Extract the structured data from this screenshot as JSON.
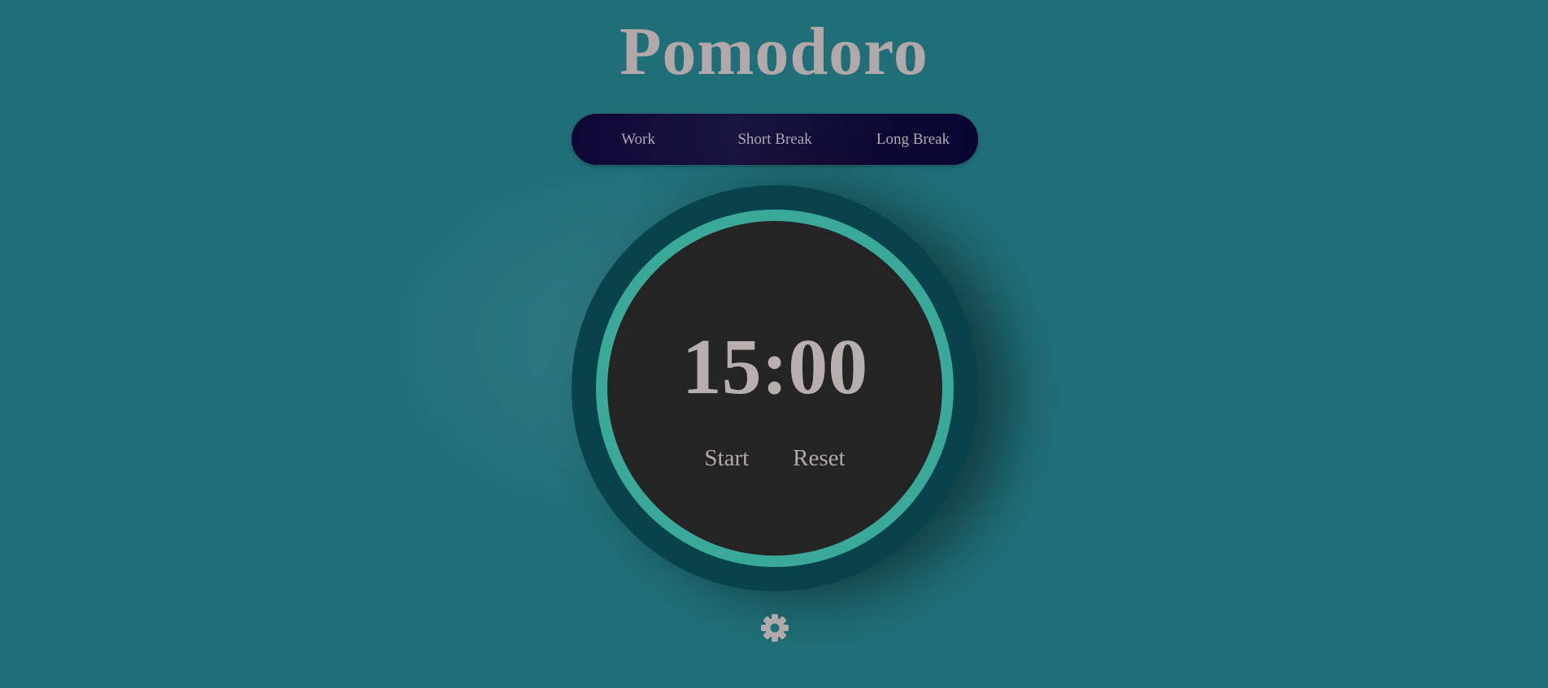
{
  "app": {
    "title": "Pomodoro"
  },
  "mode_tabs": {
    "items": [
      {
        "label": "Work"
      },
      {
        "label": "Short Break"
      },
      {
        "label": "Long Break"
      }
    ]
  },
  "timer": {
    "time": "15:00",
    "start_label": "Start",
    "reset_label": "Reset"
  },
  "settings": {
    "icon": "gear-icon"
  },
  "colors": {
    "background": "#206f78",
    "tab_bar": "#0e0736",
    "timer_outer": "#08424a",
    "progress_ring": "#3aa99a",
    "timer_face": "#242424",
    "text": "#b2a7a9"
  }
}
